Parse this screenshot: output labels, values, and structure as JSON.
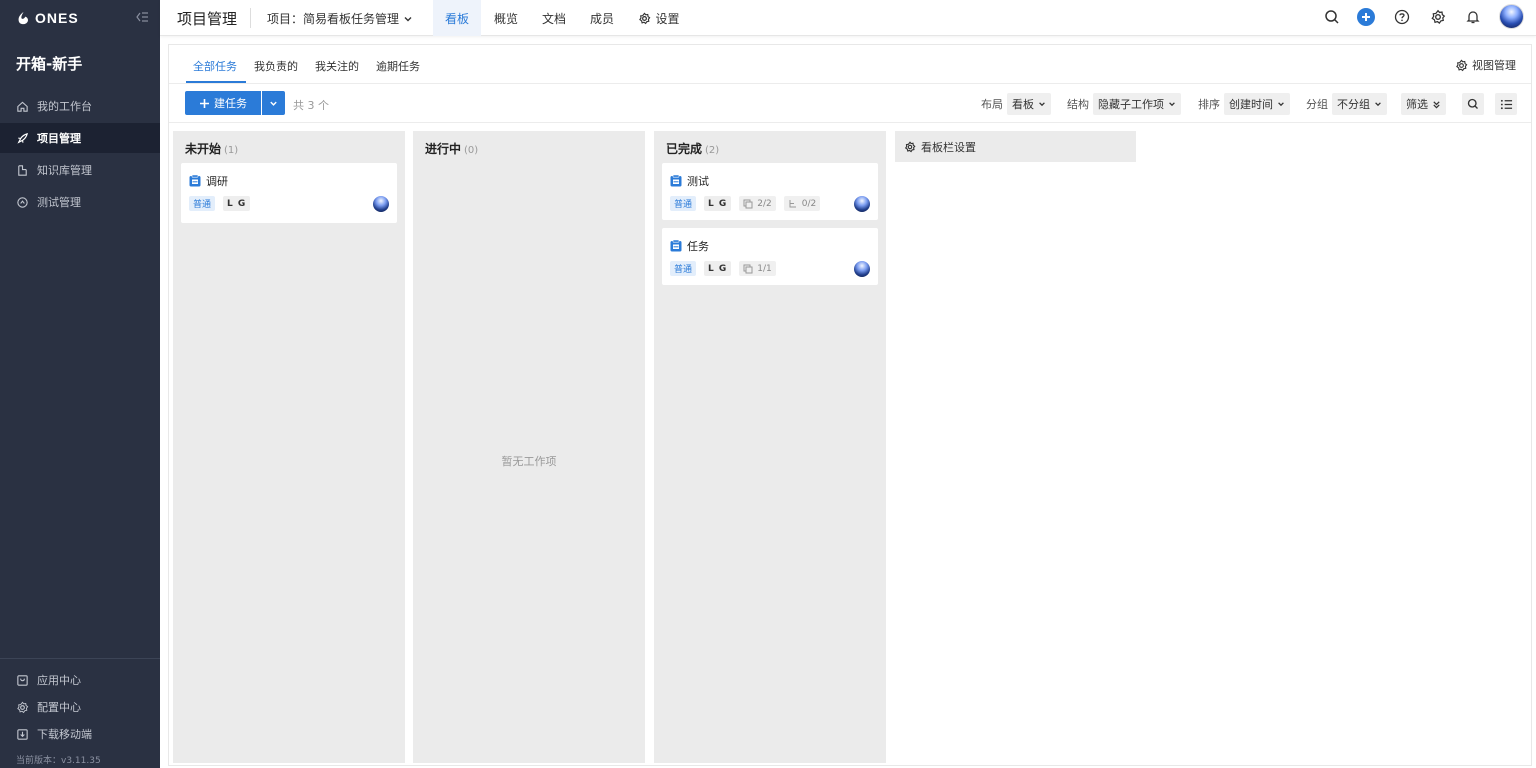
{
  "sidebar": {
    "logo_text": "ONES",
    "team_name": "开箱-新手",
    "nav": [
      {
        "label": "我的工作台",
        "icon": "home-icon"
      },
      {
        "label": "项目管理",
        "icon": "rocket-icon",
        "active": true
      },
      {
        "label": "知识库管理",
        "icon": "document-icon"
      },
      {
        "label": "测试管理",
        "icon": "test-icon"
      }
    ],
    "footer": [
      {
        "label": "应用中心",
        "icon": "app-center-icon"
      },
      {
        "label": "配置中心",
        "icon": "settings-icon"
      },
      {
        "label": "下载移动端",
        "icon": "download-icon"
      }
    ],
    "version": "当前版本：v3.11.35"
  },
  "topbar": {
    "module_title": "项目管理",
    "project_select": "项目：简易看板任务管理",
    "tabs": [
      "看板",
      "概览",
      "文档",
      "成员",
      "设置"
    ],
    "active_tab": "看板"
  },
  "subtabs": {
    "items": [
      "全部任务",
      "我负责的",
      "我关注的",
      "逾期任务"
    ],
    "active": "全部任务",
    "view_manage": "视图管理"
  },
  "toolbar": {
    "create_label": "建任务",
    "total": "共 3 个",
    "layout_label": "布局",
    "layout_value": "看板",
    "structure_label": "结构",
    "structure_value": "隐藏子工作项",
    "sort_label": "排序",
    "sort_value": "创建时间",
    "group_label": "分组",
    "group_value": "不分组",
    "filter_label": "筛选"
  },
  "board": {
    "columns": [
      {
        "title": "未开始",
        "count": "(1)",
        "cards": [
          {
            "title": "调研",
            "priority": "普通",
            "owner": "L G"
          }
        ]
      },
      {
        "title": "进行中",
        "count": "(0)",
        "empty_text": "暂无工作项",
        "cards": []
      },
      {
        "title": "已完成",
        "count": "(2)",
        "cards": [
          {
            "title": "测试",
            "priority": "普通",
            "owner": "L G",
            "subtasks": "2/2",
            "children": "0/2"
          },
          {
            "title": "任务",
            "priority": "普通",
            "owner": "L G",
            "subtasks": "1/1"
          }
        ]
      }
    ],
    "settings_label": "看板栏设置"
  },
  "colors": {
    "sidebar_bg": "#2a3142",
    "accent": "#2b7bd8",
    "column_bg": "#ebebeb"
  }
}
